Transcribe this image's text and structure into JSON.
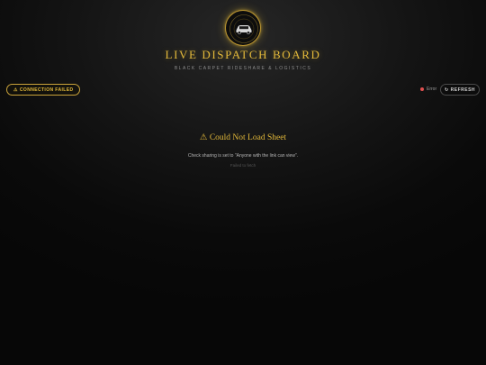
{
  "header": {
    "title": "LIVE DISPATCH BOARD",
    "subtitle": "BLACK CARPET RIDESHARE & LOGISTICS",
    "logo_icon": "car-emblem-icon"
  },
  "toolbar": {
    "connection_icon": "⚠",
    "connection_label": "CONNECTION FAILED",
    "status_label": "Error",
    "refresh_icon": "↻",
    "refresh_label": "REFRESH"
  },
  "error": {
    "icon": "⚠",
    "title": "Could Not Load Sheet",
    "message": "Check sharing is set to \"Anyone with the link can view\".",
    "detail": "Failed to fetch"
  },
  "colors": {
    "accent_gold": "#e3b93a",
    "error_red": "#e05050",
    "background": "#0a0a0a"
  }
}
